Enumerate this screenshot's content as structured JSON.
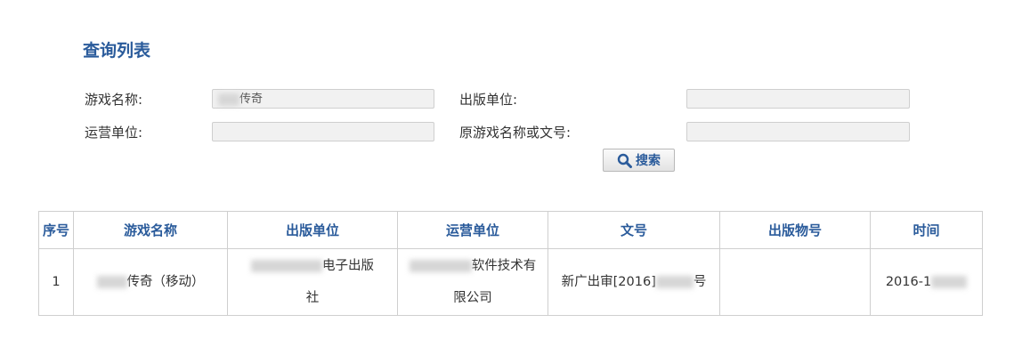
{
  "section": {
    "title": "查询列表"
  },
  "filters": {
    "game_name_label": "游戏名称:",
    "game_name_value": "传奇",
    "publisher_label": "出版单位:",
    "publisher_value": "",
    "operator_label": "运营单位:",
    "operator_value": "",
    "original_label": "原游戏名称或文号:",
    "original_value": "",
    "search_label": "搜索"
  },
  "table": {
    "headers": [
      "序号",
      "游戏名称",
      "出版单位",
      "运营单位",
      "文号",
      "出版物号",
      "时间"
    ],
    "row": {
      "index": "1",
      "game_name": "传奇（移动）",
      "publisher_line1": "电子出版",
      "publisher_line2": "社",
      "operator_line1": "软件技术有",
      "operator_line2": "限公司",
      "approval_prefix": "新广出审[2016]",
      "approval_suffix": "号",
      "pub_number": "",
      "date_prefix": "2016-1"
    }
  },
  "icons": {
    "search": "magnifier-icon"
  },
  "colors": {
    "accent": "#2a5b9b",
    "border": "#cfcfcf",
    "input_bg": "#f1f1f1"
  }
}
